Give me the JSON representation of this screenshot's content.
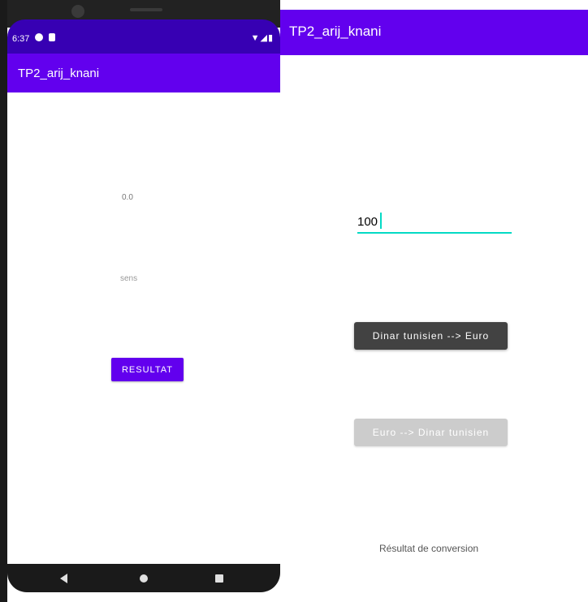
{
  "left_phone": {
    "status_bar": {
      "time": "6:37",
      "right_icons": "▼◢▮"
    },
    "app_bar": {
      "title": "TP2_arij_knani"
    },
    "value_text": "0.0",
    "sens_text": "sens",
    "resultat_button": "RESULTAT",
    "nav": {
      "back": "back-icon",
      "home": "home-icon",
      "recent": "recent-apps-icon"
    }
  },
  "right_screen": {
    "app_bar": {
      "title": "TP2_arij_knani"
    },
    "amount_input": {
      "value": "100"
    },
    "dinar_to_euro_button": "Dinar tunisien --> Euro",
    "euro_to_dinar_button": "Euro --> Dinar tunisien",
    "result_label": "Résultat de conversion"
  },
  "colors": {
    "primary": "#6200ee",
    "primary_dark": "#3700b3",
    "accent": "#03dac5",
    "button_dark": "#424242",
    "button_disabled": "#cccccc"
  }
}
